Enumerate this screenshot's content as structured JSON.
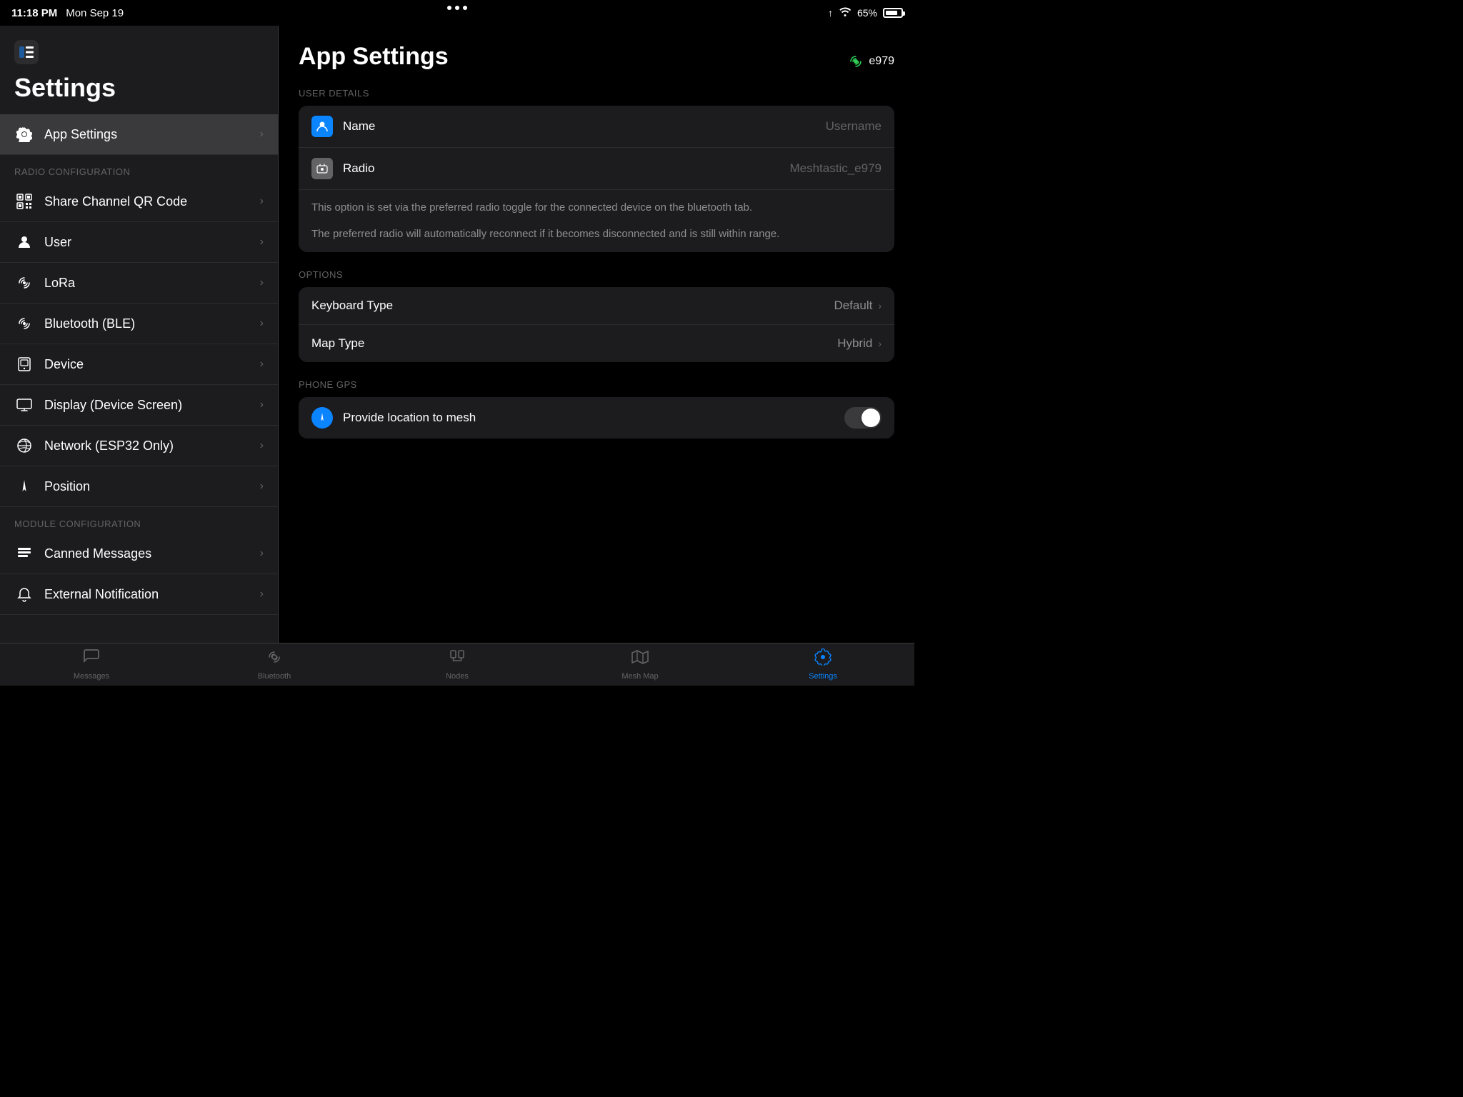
{
  "statusBar": {
    "time": "11:18 PM",
    "date": "Mon Sep 19",
    "battery": "65%",
    "deviceName": "e979"
  },
  "sidebar": {
    "title": "Settings",
    "activeItem": "App Settings",
    "sections": [
      {
        "label": null,
        "items": [
          {
            "id": "app-settings",
            "label": "App Settings",
            "icon": "gear"
          }
        ]
      },
      {
        "label": "Radio Configuration",
        "items": [
          {
            "id": "share-channel",
            "label": "Share Channel QR Code",
            "icon": "qr"
          },
          {
            "id": "user",
            "label": "User",
            "icon": "person"
          },
          {
            "id": "lora",
            "label": "LoRa",
            "icon": "lora"
          },
          {
            "id": "bluetooth",
            "label": "Bluetooth (BLE)",
            "icon": "bluetooth"
          },
          {
            "id": "device",
            "label": "Device",
            "icon": "device"
          },
          {
            "id": "display",
            "label": "Display (Device Screen)",
            "icon": "display"
          },
          {
            "id": "network",
            "label": "Network (ESP32 Only)",
            "icon": "network"
          },
          {
            "id": "position",
            "label": "Position",
            "icon": "position"
          }
        ]
      },
      {
        "label": "Module Configuration",
        "items": [
          {
            "id": "canned-messages",
            "label": "Canned Messages",
            "icon": "canned"
          },
          {
            "id": "external-notification",
            "label": "External Notification",
            "icon": "notification"
          }
        ]
      }
    ]
  },
  "main": {
    "title": "App Settings",
    "sections": {
      "userDetails": {
        "label": "User Details",
        "nameLabel": "Name",
        "namePlaceholder": "Username",
        "radioLabel": "Radio",
        "radioValue": "Meshtastic_e979",
        "infoText1": "This option is set via the preferred radio toggle for the connected device on the bluetooth tab.",
        "infoText2": "The preferred radio will automatically reconnect if it becomes disconnected and is still within range."
      },
      "options": {
        "label": "Options",
        "keyboardType": {
          "label": "Keyboard Type",
          "value": "Default"
        },
        "mapType": {
          "label": "Map Type",
          "value": "Hybrid"
        }
      },
      "phoneGps": {
        "label": "Phone GPS",
        "toggleLabel": "Provide location to mesh",
        "toggleState": false
      }
    }
  },
  "tabBar": {
    "items": [
      {
        "id": "messages",
        "label": "Messages",
        "icon": "bubble"
      },
      {
        "id": "bluetooth",
        "label": "Bluetooth",
        "icon": "bluetooth"
      },
      {
        "id": "nodes",
        "label": "Nodes",
        "icon": "nodes"
      },
      {
        "id": "mesh-map",
        "label": "Mesh Map",
        "icon": "map"
      },
      {
        "id": "settings",
        "label": "Settings",
        "icon": "gear",
        "active": true
      }
    ]
  }
}
